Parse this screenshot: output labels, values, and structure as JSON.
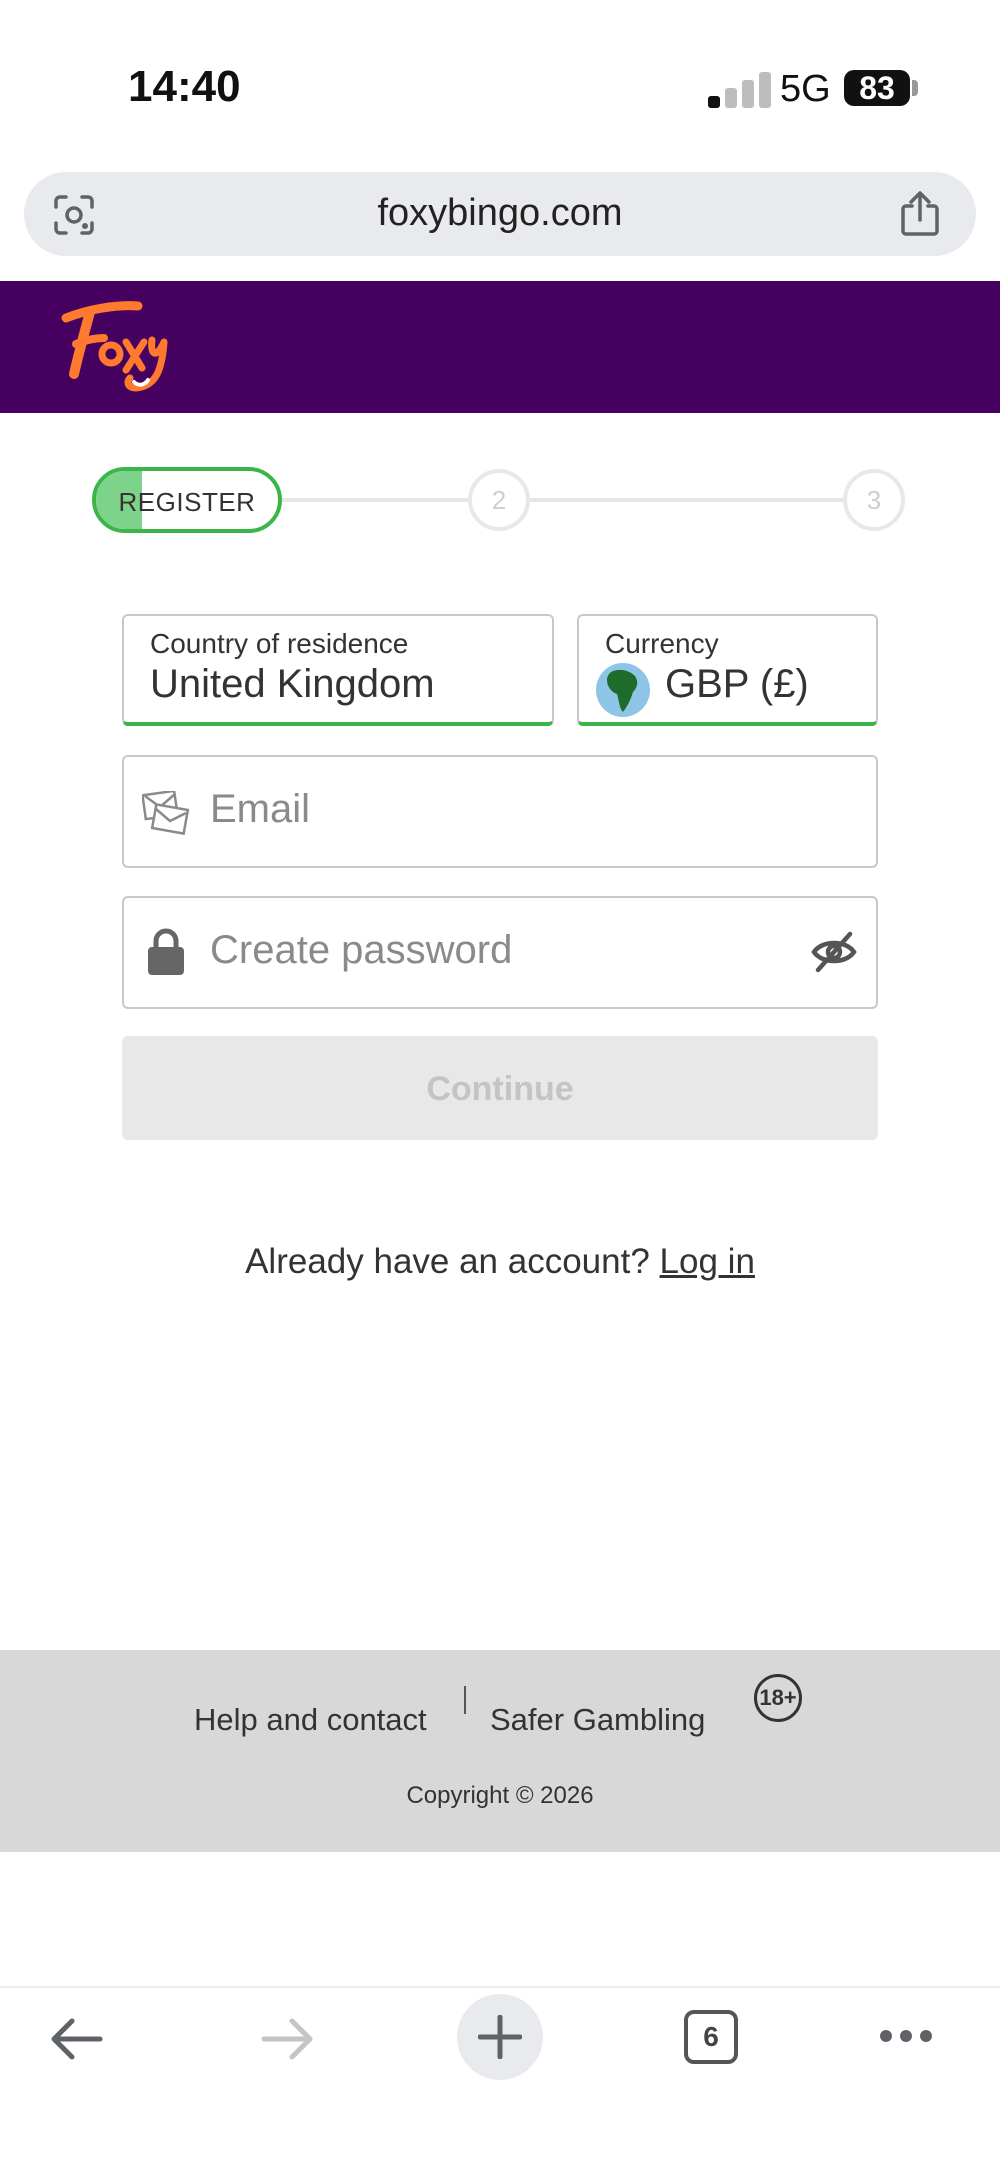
{
  "status_bar": {
    "time": "14:40",
    "network": "5G",
    "battery": "83"
  },
  "browser": {
    "url": "foxybingo.com",
    "tab_count": "6"
  },
  "stepper": {
    "steps": [
      {
        "label": "REGISTER",
        "active": true,
        "progress": 0.25
      },
      {
        "label": "2",
        "active": false
      },
      {
        "label": "3",
        "active": false
      }
    ]
  },
  "form": {
    "country": {
      "label": "Country of residence",
      "value": "United Kingdom"
    },
    "currency": {
      "label": "Currency",
      "value": "GBP (£)"
    },
    "email": {
      "placeholder": "Email",
      "value": ""
    },
    "password": {
      "placeholder": "Create password",
      "value": ""
    },
    "continue_label": "Continue"
  },
  "login": {
    "prompt": "Already have an account?",
    "link": "Log in"
  },
  "footer": {
    "help": "Help and contact",
    "safer": "Safer Gambling",
    "age": "18+",
    "copyright": "Copyright © 2026"
  },
  "colors": {
    "header_bg": "#46005f",
    "accent_green": "#3bb54a",
    "logo_orange": "#ff7a2f"
  }
}
